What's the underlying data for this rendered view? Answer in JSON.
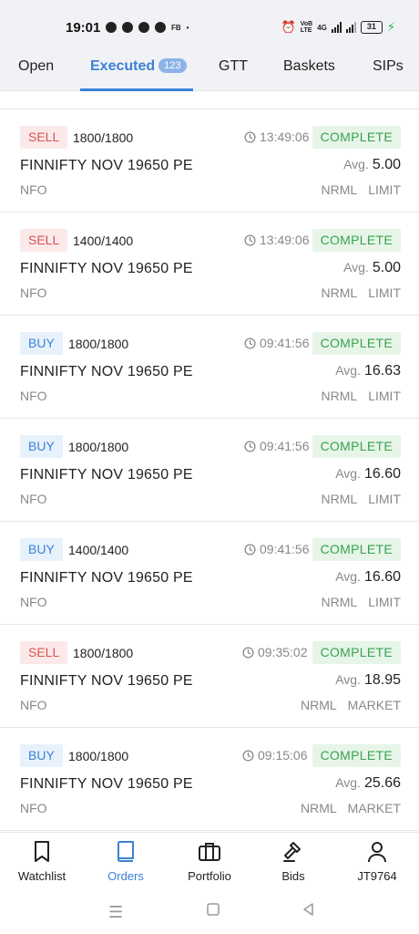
{
  "status_bar": {
    "time": "19:01",
    "app_label": "FB",
    "volte": "VoB\nLTE",
    "net_label": "4G",
    "battery": "31"
  },
  "tabs": [
    {
      "label": "Open"
    },
    {
      "label": "Executed",
      "badge": "123",
      "active": true
    },
    {
      "label": "GTT"
    },
    {
      "label": "Baskets"
    },
    {
      "label": "SIPs"
    }
  ],
  "orders": [
    {
      "side": "SELL",
      "qty": "1800/1800",
      "time": "13:49:06",
      "status": "COMPLETE",
      "symbol": "FINNIFTY NOV 19650 PE",
      "avg_label": "Avg.",
      "avg": "5.00",
      "exchange": "NFO",
      "product": "NRML",
      "order_type": "LIMIT"
    },
    {
      "side": "SELL",
      "qty": "1400/1400",
      "time": "13:49:06",
      "status": "COMPLETE",
      "symbol": "FINNIFTY NOV 19650 PE",
      "avg_label": "Avg.",
      "avg": "5.00",
      "exchange": "NFO",
      "product": "NRML",
      "order_type": "LIMIT"
    },
    {
      "side": "BUY",
      "qty": "1800/1800",
      "time": "09:41:56",
      "status": "COMPLETE",
      "symbol": "FINNIFTY NOV 19650 PE",
      "avg_label": "Avg.",
      "avg": "16.63",
      "exchange": "NFO",
      "product": "NRML",
      "order_type": "LIMIT"
    },
    {
      "side": "BUY",
      "qty": "1800/1800",
      "time": "09:41:56",
      "status": "COMPLETE",
      "symbol": "FINNIFTY NOV 19650 PE",
      "avg_label": "Avg.",
      "avg": "16.60",
      "exchange": "NFO",
      "product": "NRML",
      "order_type": "LIMIT"
    },
    {
      "side": "BUY",
      "qty": "1400/1400",
      "time": "09:41:56",
      "status": "COMPLETE",
      "symbol": "FINNIFTY NOV 19650 PE",
      "avg_label": "Avg.",
      "avg": "16.60",
      "exchange": "NFO",
      "product": "NRML",
      "order_type": "LIMIT"
    },
    {
      "side": "SELL",
      "qty": "1800/1800",
      "time": "09:35:02",
      "status": "COMPLETE",
      "symbol": "FINNIFTY NOV 19650 PE",
      "avg_label": "Avg.",
      "avg": "18.95",
      "exchange": "NFO",
      "product": "NRML",
      "order_type": "MARKET"
    },
    {
      "side": "BUY",
      "qty": "1800/1800",
      "time": "09:15:06",
      "status": "COMPLETE",
      "symbol": "FINNIFTY NOV 19650 PE",
      "avg_label": "Avg.",
      "avg": "25.66",
      "exchange": "NFO",
      "product": "NRML",
      "order_type": "MARKET"
    }
  ],
  "bottom_nav": [
    {
      "label": "Watchlist",
      "icon": "bookmark-icon"
    },
    {
      "label": "Orders",
      "icon": "book-icon",
      "active": true
    },
    {
      "label": "Portfolio",
      "icon": "briefcase-icon"
    },
    {
      "label": "Bids",
      "icon": "gavel-icon"
    },
    {
      "label": "JT9764",
      "icon": "user-icon"
    }
  ],
  "colors": {
    "accent": "#3b82d6",
    "sell": "#d9534f",
    "complete": "#3aa24f"
  }
}
